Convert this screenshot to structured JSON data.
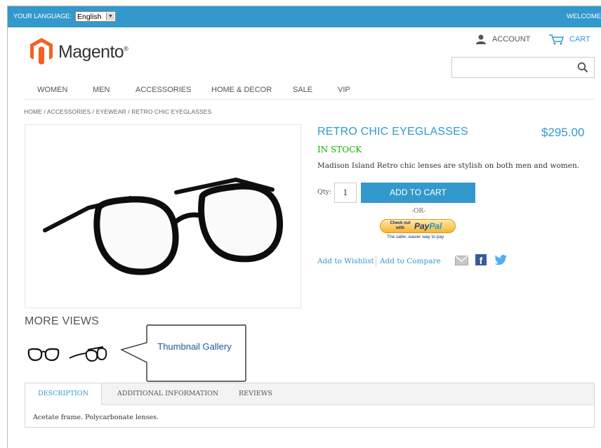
{
  "topbar": {
    "language_label": "YOUR LANGUAGE:",
    "language_value": "English",
    "welcome": "WELCOME"
  },
  "brand": {
    "name": "Magento"
  },
  "header": {
    "account_label": "ACCOUNT",
    "cart_label": "CART",
    "search_placeholder": ""
  },
  "nav": {
    "items": [
      {
        "label": "WOMEN"
      },
      {
        "label": "MEN"
      },
      {
        "label": "ACCESSORIES"
      },
      {
        "label": "HOME & DECOR"
      },
      {
        "label": "SALE"
      },
      {
        "label": "VIP"
      }
    ]
  },
  "breadcrumb": "HOME / ACCESSORIES / EYEWEAR / RETRO CHIC EYEGLASSES",
  "product": {
    "title": "RETRO CHIC EYEGLASSES",
    "price": "$295.00",
    "stock": "IN STOCK",
    "description": "Madison Island Retro chic lenses are stylish on both men and women.",
    "qty_label": "Qty:",
    "qty_value": "1",
    "add_to_cart": "ADD TO CART",
    "or_text": "-OR-",
    "paypal_checkout": "Check out with",
    "paypal_brand_a": "Pay",
    "paypal_brand_b": "Pal",
    "paypal_tagline": "The safer, easier way to pay",
    "add_to_wishlist": "Add to Wishlist",
    "add_to_compare": "Add to Compare"
  },
  "more_views": {
    "heading": "MORE VIEWS",
    "callout": "Thumbnail Gallery"
  },
  "tabs": {
    "items": [
      {
        "label": "DESCRIPTION"
      },
      {
        "label": "ADDITIONAL INFORMATION"
      },
      {
        "label": "REVIEWS"
      }
    ],
    "content": "Acetate frame. Polycarbonate lenses."
  },
  "colors": {
    "accent": "#3399cc",
    "stock": "#11b400",
    "logo_orange": "#f26322",
    "facebook": "#3b5998",
    "twitter": "#55acee"
  }
}
